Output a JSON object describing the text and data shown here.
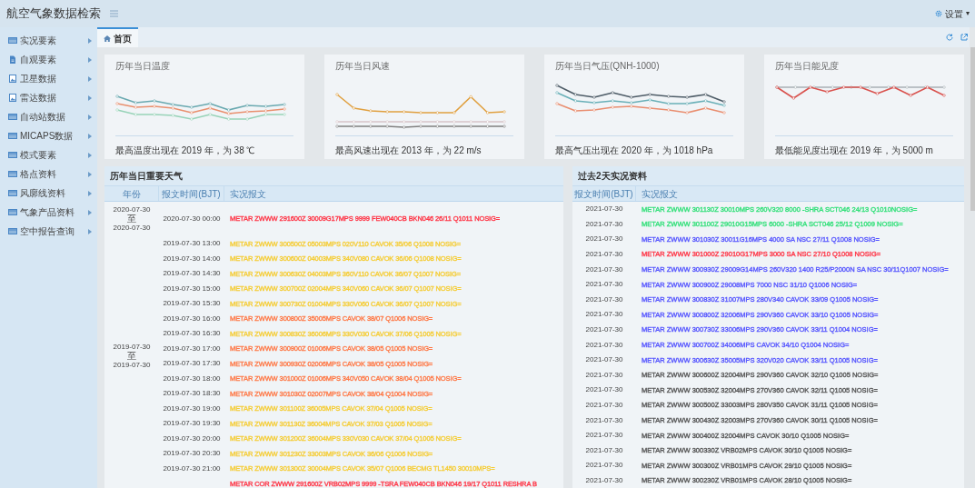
{
  "app_title": "航空气象数据检索",
  "settings": {
    "label": "设置",
    "caret": "▾"
  },
  "sidebar": {
    "items": [
      {
        "label": "实况要素",
        "kind": "table"
      },
      {
        "label": "自观要素",
        "kind": "document"
      },
      {
        "label": "卫星数据",
        "kind": "image"
      },
      {
        "label": "雷达数据",
        "kind": "image"
      },
      {
        "label": "自动站数据",
        "kind": "table"
      },
      {
        "label": "MICAPS数据",
        "kind": "table"
      },
      {
        "label": "模式要素",
        "kind": "table"
      },
      {
        "label": "格点资料",
        "kind": "table"
      },
      {
        "label": "风廓线资料",
        "kind": "table"
      },
      {
        "label": "气象产品资料",
        "kind": "table"
      },
      {
        "label": "空中报告查询",
        "kind": "table"
      }
    ]
  },
  "tabs": [
    {
      "label": "首页",
      "selected": true
    }
  ],
  "cards": [
    {
      "title": "历年当日温度",
      "summary": "最高温度出现在 2019 年，为 38 ℃",
      "kind": "temperature"
    },
    {
      "title": "历年当日风速",
      "summary": "最高风速出现在 2013 年，为 22 m/s",
      "kind": "wind"
    },
    {
      "title": "历年当日气压(QNH-1000)",
      "summary": "最高气压出现在 2020 年，为 1018 hPa",
      "kind": "pressure"
    },
    {
      "title": "历年当日能见度",
      "summary": "最低能见度出现在 2019 年，为 5000 m",
      "kind": "visibility"
    }
  ],
  "important_weather": {
    "title": "历年当日重要天气",
    "columns": [
      "年份",
      "报文时间(BJT)",
      "实况报文"
    ],
    "groups": [
      {
        "from": "2020-07-30",
        "sep": "至",
        "to": "2020-07-30",
        "rows": [
          {
            "time": "2020-07-30 00:00",
            "report": "METAR ZWWW 291600Z 30009G17MPS 9999 FEW040CB BKN046 26/11 Q1011 NOSIG=",
            "color": "#ff3344"
          }
        ]
      },
      {
        "from": "2019-07-30",
        "sep": "至",
        "to": "2019-07-30",
        "rows": [
          {
            "time": "2019-07-30 13:00",
            "report": "METAR ZWWW 300500Z 05003MPS 020V110 CAVOK 35/06 Q1008 NOSIG=",
            "color": "#f5cc33"
          },
          {
            "time": "2019-07-30 14:00",
            "report": "METAR ZWWW 300600Z 04003MPS 340V080 CAVOK 36/06 Q1008 NOSIG=",
            "color": "#f5cc33"
          },
          {
            "time": "2019-07-30 14:30",
            "report": "METAR ZWWW 300630Z 04003MPS 360V110 CAVOK 36/07 Q1007 NOSIG=",
            "color": "#f5cc33"
          },
          {
            "time": "2019-07-30 15:00",
            "report": "METAR ZWWW 300700Z 02004MPS 340V060 CAVOK 36/07 Q1007 NOSIG=",
            "color": "#f5cc33"
          },
          {
            "time": "2019-07-30 15:30",
            "report": "METAR ZWWW 300730Z 01004MPS 330V060 CAVOK 36/07 Q1007 NOSIG=",
            "color": "#f5cc33"
          },
          {
            "time": "2019-07-30 16:00",
            "report": "METAR ZWWW 300800Z 35005MPS CAVOK 38/07 Q1006 NOSIG=",
            "color": "#ff7744"
          },
          {
            "time": "2019-07-30 16:30",
            "report": "METAR ZWWW 300830Z 36006MPS 330V030 CAVOK 37/06 Q1005 NOSIG=",
            "color": "#f5cc33"
          },
          {
            "time": "2019-07-30 17:00",
            "report": "METAR ZWWW 300900Z 01006MPS CAVOK 38/05 Q1005 NOSIG=",
            "color": "#ff7744"
          },
          {
            "time": "2019-07-30 17:30",
            "report": "METAR ZWWW 300930Z 02006MPS CAVOK 38/05 Q1005 NOSIG=",
            "color": "#ff7744"
          },
          {
            "time": "2019-07-30 18:00",
            "report": "METAR ZWWW 301000Z 01006MPS 340V050 CAVOK 38/04 Q1005 NOSIG=",
            "color": "#ff7744"
          },
          {
            "time": "2019-07-30 18:30",
            "report": "METAR ZWWW 301030Z 02007MPS CAVOK 38/04 Q1004 NOSIG=",
            "color": "#ff7744"
          },
          {
            "time": "2019-07-30 19:00",
            "report": "METAR ZWWW 301100Z 36005MPS CAVOK 37/04 Q1005 NOSIG=",
            "color": "#f5cc33"
          },
          {
            "time": "2019-07-30 19:30",
            "report": "METAR ZWWW 301130Z 36004MPS CAVOK 37/03 Q1005 NOSIG=",
            "color": "#f5cc33"
          },
          {
            "time": "2019-07-30 20:00",
            "report": "METAR ZWWW 301200Z 36004MPS 330V030 CAVOK 37/04 Q1005 NOSIG=",
            "color": "#f5cc33"
          },
          {
            "time": "2019-07-30 20:30",
            "report": "METAR ZWWW 301230Z 33003MPS CAVOK 36/06 Q1006 NOSIG=",
            "color": "#f5cc33"
          },
          {
            "time": "2019-07-30 21:00",
            "report": "METAR ZWWW 301300Z 30004MPS CAVOK 35/07 Q1006 BECMG TL1450 30010MPS=",
            "color": "#f5cc33"
          }
        ]
      },
      {
        "rows": [
          {
            "report": "METAR COR ZWWW 291600Z VRB02MPS 9999 -TSRA FEW040CB BKN046 19/17 Q1011 RESHRA B",
            "color": "#ff3344"
          }
        ]
      }
    ]
  },
  "recent": {
    "title": "过去2天实况资料",
    "columns": [
      "报文时间(BJT)",
      "实况报文"
    ],
    "rows": [
      {
        "time": "2021-07-30",
        "report": "METAR ZWWW 301130Z 30010MPS 260V320 8000 -SHRA SCT046 24/13 Q1010NOSIG=",
        "color": "#33e07a"
      },
      {
        "time": "2021-07-30",
        "report": "METAR ZWWW 301100Z 29010G15MPS 6000 -SHRA SCT046 25/12 Q1009 NOSIG=",
        "color": "#33e07a"
      },
      {
        "time": "2021-07-30",
        "report": "METAR ZWWW 301030Z 30011G16MPS 4000 SA NSC 27/11 Q1008 NOSIG=",
        "color": "#5555ff"
      },
      {
        "time": "2021-07-30",
        "report": "METAR ZWWW 301000Z 29010G17MPS 3000 SA NSC 27/10 Q1008 NOSIG=",
        "color": "#ff3344"
      },
      {
        "time": "2021-07-30",
        "report": "METAR ZWWW 300930Z 29009G14MPS 260V320 1400 R25/P2000N SA NSC 30/11Q1007 NOSIG=",
        "color": "#5555ff"
      },
      {
        "time": "2021-07-30",
        "report": "METAR ZWWW 300900Z 29008MPS 7000 NSC 31/10 Q1006 NOSIG=",
        "color": "#5555ff"
      },
      {
        "time": "2021-07-30",
        "report": "METAR ZWWW 300830Z 31007MPS 280V340 CAVOK 33/09 Q1005 NOSIG=",
        "color": "#5555ff"
      },
      {
        "time": "2021-07-30",
        "report": "METAR ZWWW 300800Z 32006MPS 290V360 CAVOK 33/10 Q1005 NOSIG=",
        "color": "#5555ff"
      },
      {
        "time": "2021-07-30",
        "report": "METAR ZWWW 300730Z 33006MPS 290V360 CAVOK 33/11 Q1004 NOSIG=",
        "color": "#5555ff"
      },
      {
        "time": "2021-07-30",
        "report": "METAR ZWWW 300700Z 34006MPS CAVOK 34/10 Q1004 NOSIG=",
        "color": "#5555ff"
      },
      {
        "time": "2021-07-30",
        "report": "METAR ZWWW 300630Z 35005MPS 320V020 CAVOK 33/11 Q1005 NOSIG=",
        "color": "#5555ff"
      },
      {
        "time": "2021-07-30",
        "report": "METAR ZWWW 300600Z 32004MPS 290V360 CAVOK 32/10 Q1005 NOSIG=",
        "color": "#555555"
      },
      {
        "time": "2021-07-30",
        "report": "METAR ZWWW 300530Z 32004MPS 270V360 CAVOK 32/11 Q1005 NOSIG=",
        "color": "#555555"
      },
      {
        "time": "2021-07-30",
        "report": "METAR ZWWW 300500Z 33003MPS 280V350 CAVOK 31/11 Q1005 NOSIG=",
        "color": "#555555"
      },
      {
        "time": "2021-07-30",
        "report": "METAR ZWWW 300430Z 32003MPS 270V360 CAVOK 30/11 Q1005 NOSIG=",
        "color": "#555555"
      },
      {
        "time": "2021-07-30",
        "report": "METAR ZWWW 300400Z 32004MPS CAVOK 30/10 Q1005 NOSIG=",
        "color": "#555555"
      },
      {
        "time": "2021-07-30",
        "report": "METAR ZWWW 300330Z VRB02MPS CAVOK 30/10 Q1005 NOSIG=",
        "color": "#555555"
      },
      {
        "time": "2021-07-30",
        "report": "METAR ZWWW 300300Z VRB01MPS CAVOK 29/10 Q1005 NOSIG=",
        "color": "#555555"
      },
      {
        "time": "2021-07-30",
        "report": "METAR ZWWW 300230Z VRB01MPS CAVOK 28/10 Q1005 NOSIG=",
        "color": "#555555"
      }
    ]
  }
}
